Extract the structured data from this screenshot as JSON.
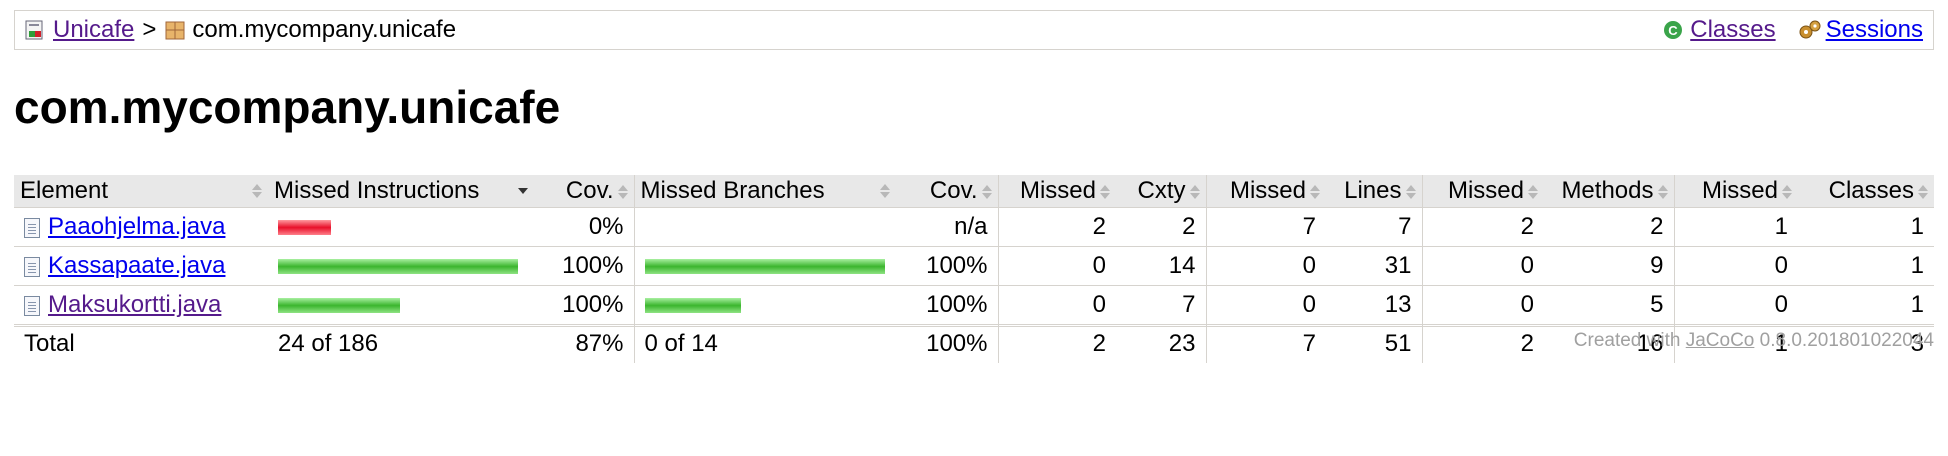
{
  "breadcrumb": {
    "root_link": "Unicafe",
    "separator": ">",
    "current": "com.mycompany.unicafe",
    "classes_link": "Classes",
    "sessions_link": "Sessions"
  },
  "page_title": "com.mycompany.unicafe",
  "table": {
    "headers": [
      "Element",
      "Missed Instructions",
      "Cov.",
      "Missed Branches",
      "Cov.",
      "Missed",
      "Cxty",
      "Missed",
      "Lines",
      "Missed",
      "Methods",
      "Missed",
      "Classes"
    ],
    "rows": [
      {
        "element": "Paaohjelma.java",
        "instr_cov": "0%",
        "instr_red": 1.0,
        "instr_green": 0.0,
        "branch_cov": "n/a",
        "branch_green": 0.0,
        "missed_cxty": "2",
        "cxty": "2",
        "missed_lines": "7",
        "lines": "7",
        "missed_methods": "2",
        "methods": "2",
        "missed_classes": "1",
        "classes": "1"
      },
      {
        "element": "Kassapaate.java",
        "instr_cov": "100%",
        "instr_red": 0.0,
        "instr_green": 1.0,
        "branch_cov": "100%",
        "branch_green": 1.0,
        "missed_cxty": "0",
        "cxty": "14",
        "missed_lines": "0",
        "lines": "31",
        "missed_methods": "0",
        "methods": "9",
        "missed_classes": "0",
        "classes": "1"
      },
      {
        "element": "Maksukortti.java",
        "instr_cov": "100%",
        "instr_red": 0.0,
        "instr_green": 0.51,
        "branch_cov": "100%",
        "branch_green": 0.4,
        "missed_cxty": "0",
        "cxty": "7",
        "missed_lines": "0",
        "lines": "13",
        "missed_methods": "0",
        "methods": "5",
        "missed_classes": "0",
        "classes": "1"
      }
    ],
    "total": {
      "label": "Total",
      "instr": "24 of 186",
      "instr_cov": "87%",
      "branch": "0 of 14",
      "branch_cov": "100%",
      "missed_cxty": "2",
      "cxty": "23",
      "missed_lines": "7",
      "lines": "51",
      "missed_methods": "2",
      "methods": "16",
      "missed_classes": "1",
      "classes": "3"
    }
  },
  "footer": {
    "prefix": "Created with",
    "link": "JaCoCo",
    "version": "0.8.0.201801022044"
  }
}
